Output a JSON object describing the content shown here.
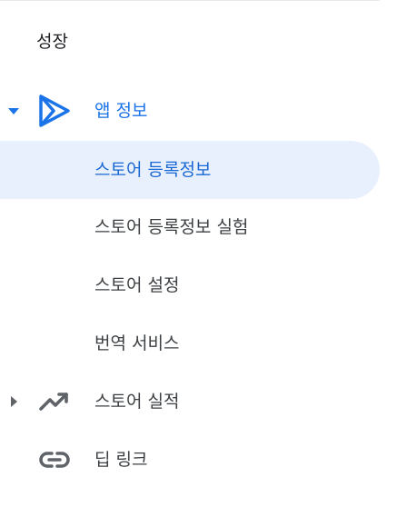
{
  "sidebar": {
    "section_title": "성장",
    "items": [
      {
        "label": "앱 정보",
        "icon": "play-console-icon",
        "state": "expanded"
      },
      {
        "label": "스토어 등록정보",
        "state": "selected"
      },
      {
        "label": "스토어 등록정보 실험"
      },
      {
        "label": "스토어 설정"
      },
      {
        "label": "번역 서비스"
      },
      {
        "label": "스토어 실적",
        "icon": "trending-up-icon",
        "state": "collapsed"
      },
      {
        "label": "딥 링크",
        "icon": "link-icon"
      }
    ]
  },
  "colors": {
    "accent": "#1a73e8",
    "selected_bg": "#e8f0fe",
    "text": "#3c4043",
    "icon": "#5f6368"
  }
}
